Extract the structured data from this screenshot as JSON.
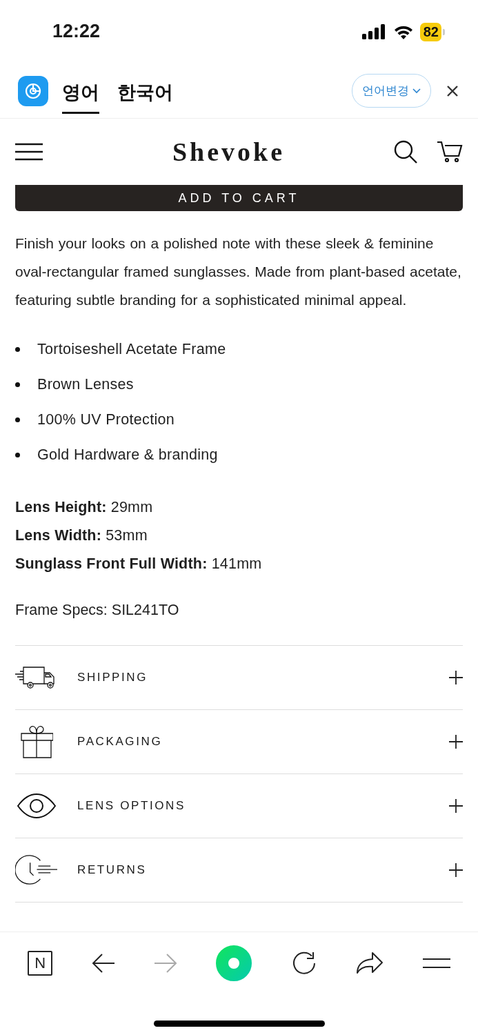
{
  "status_bar": {
    "time": "12:22",
    "battery": "82"
  },
  "translate_bar": {
    "tabs": [
      {
        "label": "영어",
        "selected": true
      },
      {
        "label": "한국어",
        "selected": false
      }
    ],
    "change_button": "언어변경"
  },
  "header": {
    "logo": "Shevoke"
  },
  "add_to_cart": "ADD TO CART",
  "description": "Finish your looks on a polished note with these sleek & feminine oval-rectangular framed sunglasses. Made from plant-based acetate, featuring subtle branding for a sophisticated minimal appeal.",
  "features": [
    "Tortoiseshell Acetate Frame",
    "Brown Lenses",
    "100% UV Protection",
    "Gold Hardware & branding"
  ],
  "specs": [
    "**Lens Height:** 29mm",
    "**Lens Width:** 53mm",
    "**Sunglass Front Full Width:** 141mm"
  ],
  "frame_specs": "Frame Specs: SIL241TO",
  "accordion": [
    {
      "kind": "truck",
      "label": "SHIPPING",
      "expanded": false
    },
    {
      "kind": "gift",
      "label": "PACKAGING",
      "expanded": false
    },
    {
      "kind": "eye",
      "label": "LENS OPTIONS",
      "expanded": false
    },
    {
      "kind": "clock",
      "label": "RETURNS",
      "expanded": false
    }
  ],
  "toolbar": [
    {
      "kind": "home",
      "label": "N",
      "disabled": false
    },
    {
      "kind": "back",
      "disabled": false
    },
    {
      "kind": "forward",
      "disabled": true
    },
    {
      "kind": "green",
      "disabled": false
    },
    {
      "kind": "reload",
      "disabled": false
    },
    {
      "kind": "share",
      "disabled": false
    },
    {
      "kind": "menu",
      "disabled": false
    }
  ]
}
